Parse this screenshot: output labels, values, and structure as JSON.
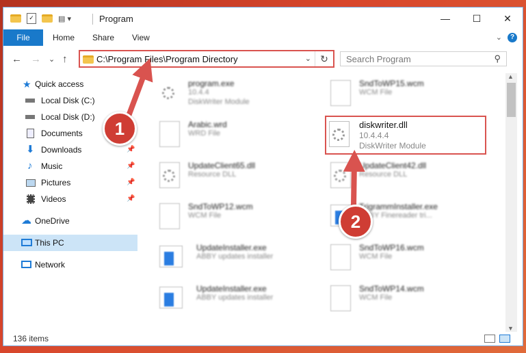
{
  "window": {
    "title": "Program",
    "minimize_glyph": "—",
    "maximize_glyph": "☐",
    "close_glyph": "✕"
  },
  "ribbon": {
    "tabs": [
      "File",
      "Home",
      "Share",
      "View"
    ],
    "help_glyph": "?",
    "collapse_glyph": "⌄"
  },
  "nav": {
    "back_glyph": "←",
    "forward_glyph": "→",
    "recent_glyph": "⌄",
    "up_glyph": "↑",
    "address": "C:\\Program Files\\Program Directory",
    "address_dropdown_glyph": "⌄",
    "refresh_glyph": "↻",
    "search_placeholder": "Search Program",
    "search_glyph": "⚲"
  },
  "sidebar": {
    "items": [
      {
        "label": "Quick access",
        "icon": "star-icon"
      },
      {
        "label": "Local Disk (C:)",
        "icon": "drive-icon"
      },
      {
        "label": "Local Disk (D:)",
        "icon": "drive-icon"
      },
      {
        "label": "Documents",
        "icon": "documents-icon"
      },
      {
        "label": "Downloads",
        "icon": "download-icon",
        "pin": "📌"
      },
      {
        "label": "Music",
        "icon": "music-icon",
        "pin": "📌"
      },
      {
        "label": "Pictures",
        "icon": "pictures-icon",
        "pin": "📌"
      },
      {
        "label": "Videos",
        "icon": "videos-icon",
        "pin": "📌"
      },
      {
        "label": "OneDrive",
        "icon": "cloud-icon"
      },
      {
        "label": "This PC",
        "icon": "computer-icon"
      },
      {
        "label": "Network",
        "icon": "network-icon"
      }
    ]
  },
  "files": {
    "left": [
      {
        "name": "program.exe",
        "line2": "10.4.4",
        "line3": "DiskWriter Module",
        "icon": "exe-file-icon"
      },
      {
        "name": "Arabic.wrd",
        "line2": "WRD File",
        "line3": "",
        "icon": "file-icon"
      },
      {
        "name": "UpdateClient65.dll",
        "line2": "Resource DLL",
        "line3": "",
        "icon": "dll-file-icon"
      },
      {
        "name": "SndToWP12.wcm",
        "line2": "WCM File",
        "line3": "",
        "icon": "file-icon"
      },
      {
        "name": "UpdateInstaller.exe",
        "line2": "ABBY updates installer",
        "line3": "",
        "icon": "installer-icon"
      },
      {
        "name": "UpdateInstaller.exe",
        "line2": "ABBY updates installer",
        "line3": "",
        "icon": "installer-icon"
      }
    ],
    "right": [
      {
        "name": "SndToWP15.wcm",
        "line2": "WCM File",
        "line3": "",
        "icon": "file-icon"
      },
      {
        "name": "diskwriter.dll",
        "line2": "10.4.4.4",
        "line3": "DiskWriter Module",
        "icon": "dll-file-icon"
      },
      {
        "name": "UpdateClient42.dll",
        "line2": "Resource DLL",
        "line3": "",
        "icon": "dll-file-icon"
      },
      {
        "name": "TrigrammInstaller.exe",
        "line2": "ABBY Finereader tri...",
        "line3": "",
        "icon": "installer-icon"
      },
      {
        "name": "SndToWP16.wcm",
        "line2": "WCM File",
        "line3": "",
        "icon": "file-icon"
      },
      {
        "name": "SndToWP14.wcm",
        "line2": "WCM File",
        "line3": "",
        "icon": "file-icon"
      }
    ]
  },
  "status": {
    "item_count": "136 items"
  },
  "annotations": {
    "step1": "1",
    "step2": "2",
    "accent": "#d9534f"
  }
}
